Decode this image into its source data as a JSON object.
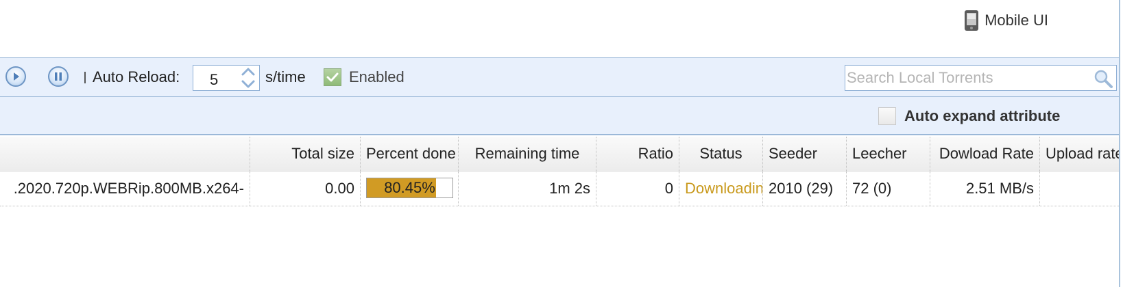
{
  "header": {
    "mobile_ui_label": "Mobile UI",
    "mobile_icon": "mobile-phone-icon"
  },
  "toolbar": {
    "play_icon": "play-icon",
    "pause_icon": "pause-icon",
    "auto_reload_label": "Auto Reload:",
    "auto_reload_value": "5",
    "unit_label": "s/time",
    "enabled_checked": true,
    "enabled_label": "Enabled",
    "search_placeholder": "Search Local Torrents",
    "search_value": "",
    "search_icon": "magnifier-icon"
  },
  "attribute_bar": {
    "auto_expand_checked": false,
    "auto_expand_label": "Auto expand attribute"
  },
  "table": {
    "columns": [
      "",
      "Total size",
      "Percent done",
      "Remaining time",
      "Ratio",
      "Status",
      "Seeder",
      "Leecher",
      "Dowload Rate",
      "Upload rate"
    ],
    "rows": [
      {
        "name": ".2020.720p.WEBRip.800MB.x264-",
        "total_size": "0.00",
        "percent_done": "80.45%",
        "percent_value": 80.45,
        "remaining_time": "1m 2s",
        "ratio": "0",
        "status": "Downloading",
        "seeder": "2010 (29)",
        "leecher": "72 (0)",
        "download_rate": "2.51 MB/s",
        "upload_rate": ""
      }
    ]
  },
  "colors": {
    "toolbar_bg": "#e8f0fc",
    "border_blue": "#9bb8d8",
    "progress_fill": "#d19b24",
    "status_downloading": "#c99a1e"
  }
}
